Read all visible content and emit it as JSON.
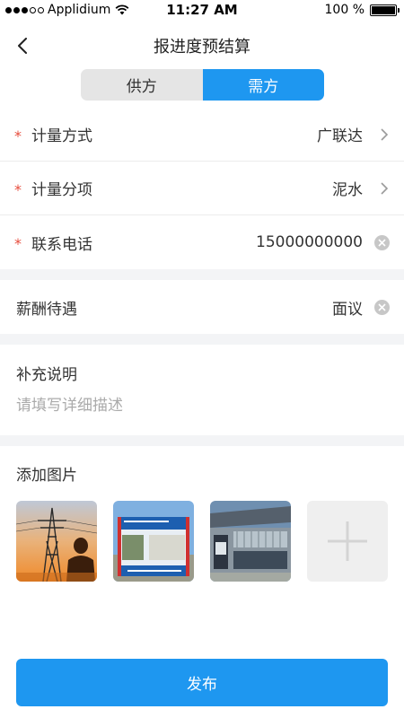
{
  "status_bar": {
    "carrier": "Applidium",
    "time": "11:27 AM",
    "battery_percent": "100 %",
    "battery_level": 1.0
  },
  "nav": {
    "title": "报进度预结算",
    "back_icon": "chevron-left-icon"
  },
  "segments": [
    {
      "label": "供方",
      "active": false
    },
    {
      "label": "需方",
      "active": true
    }
  ],
  "form": {
    "measure_method": {
      "label": "计量方式",
      "value": "广联达",
      "required_mark": "*"
    },
    "measure_item": {
      "label": "计量分项",
      "value": "泥水",
      "required_mark": "*"
    },
    "phone": {
      "label": "联系电话",
      "value": "15000000000",
      "required_mark": "*"
    },
    "salary": {
      "label": "薪酬待遇",
      "value": "面议"
    }
  },
  "notes": {
    "label": "补充说明",
    "placeholder": "请填写详细描述"
  },
  "images": {
    "label": "添加图片",
    "thumbnails": [
      "power-tower-photo",
      "construction-sign-photo",
      "sport-building-photo"
    ],
    "add_icon": "plus-icon"
  },
  "publish_label": "发布",
  "colors": {
    "accent": "#1e97f0",
    "required": "#e74c3c",
    "section_gap": "#f3f4f6"
  }
}
